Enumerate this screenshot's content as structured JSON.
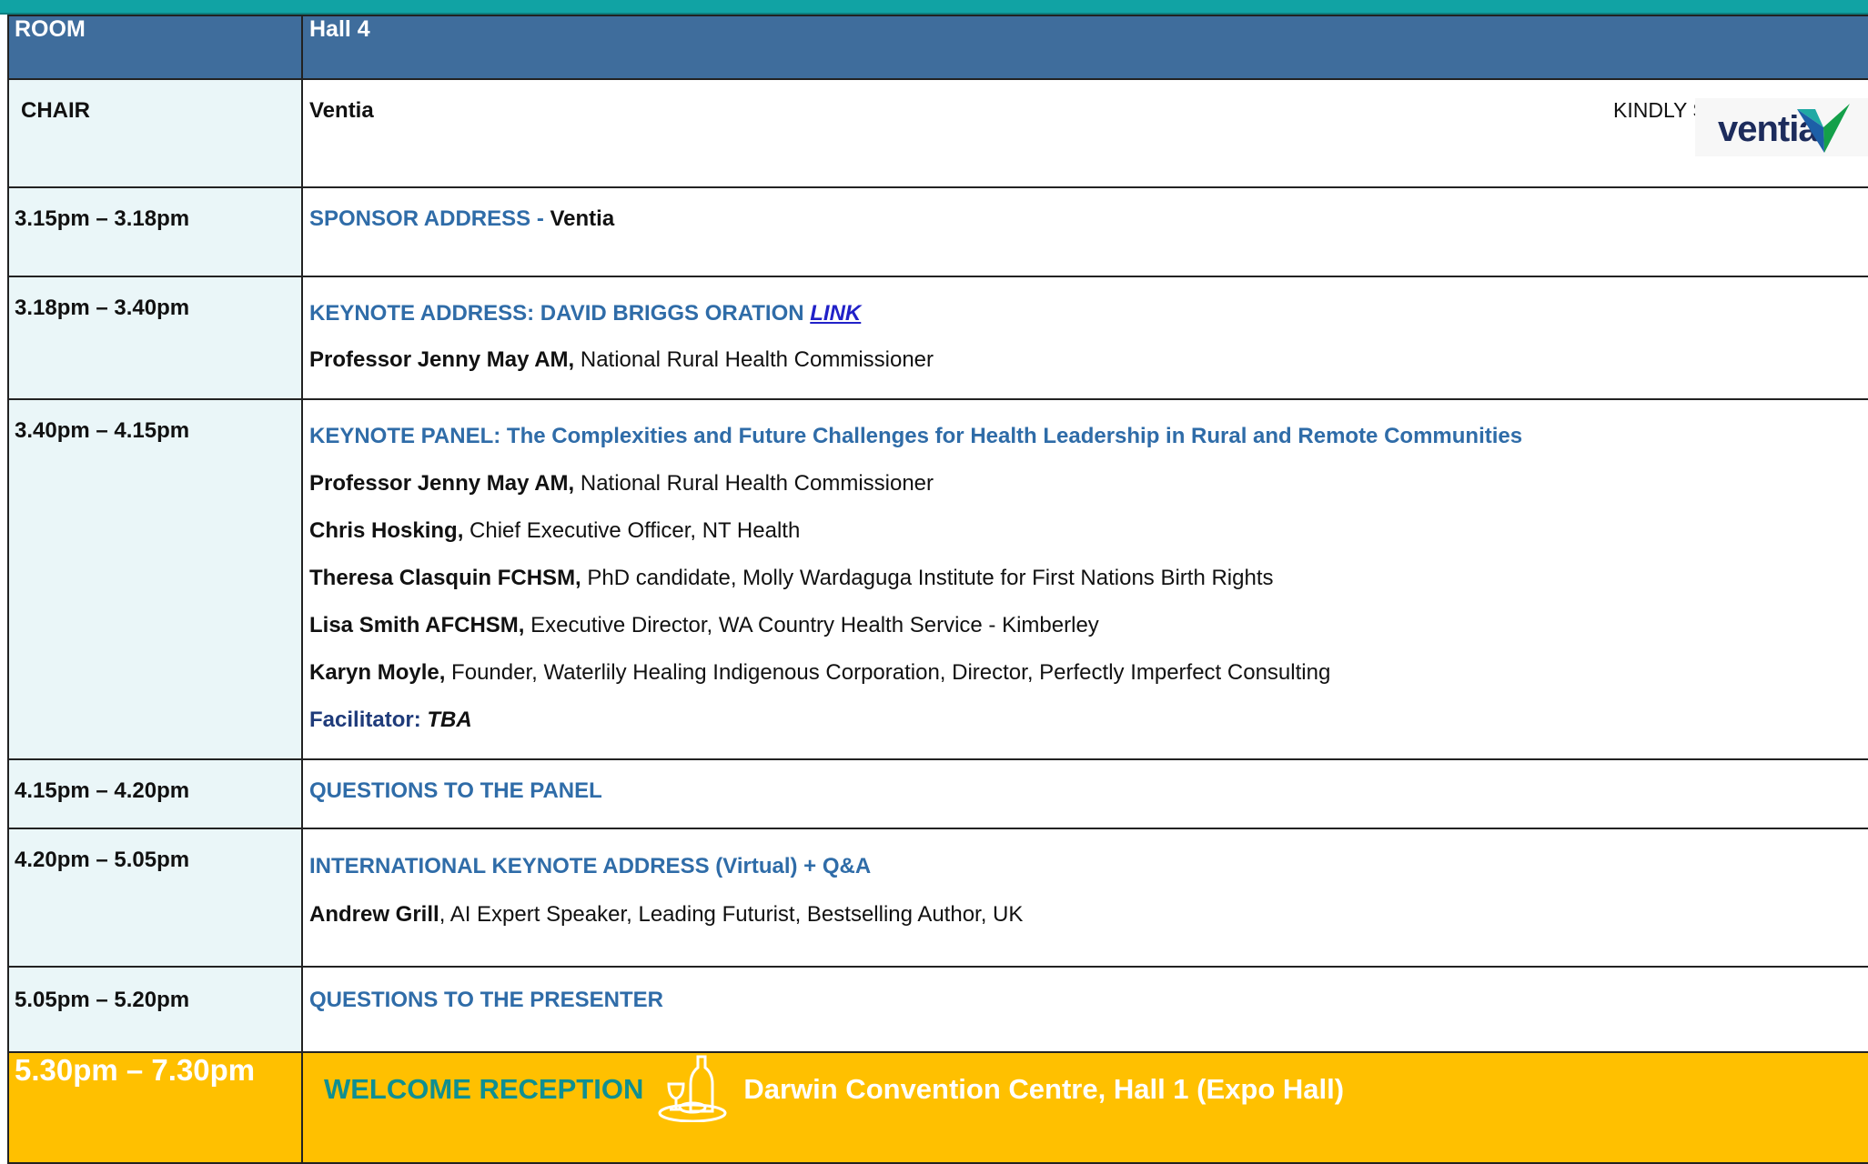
{
  "header": {
    "room_label": "ROOM",
    "room_value": "Hall 4"
  },
  "chair": {
    "label": "CHAIR",
    "value": "Ventia",
    "supported_text": "KINDLY SUPPORTED BY",
    "logo_text": "ventia"
  },
  "sessions": {
    "s1": {
      "time": "3.15pm – 3.18pm",
      "title": "SPONSOR ADDRESS - ",
      "title_suffix": "Ventia"
    },
    "s2": {
      "time": "3.18pm – 3.40pm",
      "title": "KEYNOTE ADDRESS: DAVID BRIGGS ORATION ",
      "link": "LINK",
      "speaker_name": "Professor Jenny May AM,",
      "speaker_role": " National Rural Health Commissioner"
    },
    "s3": {
      "time": "3.40pm – 4.15pm",
      "title": "KEYNOTE PANEL: The Complexities and Future Challenges for Health Leadership in Rural and Remote Communities",
      "panel": [
        {
          "name": "Professor Jenny May AM,",
          "role": " National Rural Health Commissioner"
        },
        {
          "name": "Chris Hosking,",
          "role": " Chief Executive Officer, NT Health"
        },
        {
          "name": "Theresa Clasquin FCHSM,",
          "role": " PhD candidate, Molly Wardaguga Institute for First Nations Birth Rights"
        },
        {
          "name": "Lisa Smith AFCHSM,",
          "role": " Executive Director, WA Country Health Service - Kimberley"
        },
        {
          "name": "Karyn Moyle,",
          "role": " Founder, Waterlily Healing Indigenous Corporation, Director, Perfectly Imperfect Consulting"
        }
      ],
      "facilitator_label": "Facilitator: ",
      "facilitator_value": "TBA"
    },
    "s4": {
      "time": "4.15pm – 4.20pm",
      "title": "QUESTIONS TO THE PANEL"
    },
    "s5": {
      "time": "4.20pm – 5.05pm",
      "title": "INTERNATIONAL KEYNOTE ADDRESS (Virtual) + Q&A",
      "speaker_name": "Andrew Grill",
      "speaker_role": ", AI Expert Speaker, Leading Futurist, Bestselling Author, UK"
    },
    "s6": {
      "time": "5.05pm – 5.20pm",
      "title": "QUESTIONS TO THE PRESENTER"
    }
  },
  "reception": {
    "time": "5.30pm – 7.30pm",
    "title": "WELCOME RECEPTION",
    "icon": "dinner-wine-icon",
    "venue": "Darwin Convention Centre, Hall 1 (Expo Hall)"
  },
  "colors": {
    "top_bar": "#11a3a4",
    "header_bg": "#3f6d9c",
    "time_bg": "#eaf6f8",
    "session_title": "#2f6ca8",
    "reception_bg": "#ffc000",
    "reception_title": "#0f8f91"
  }
}
